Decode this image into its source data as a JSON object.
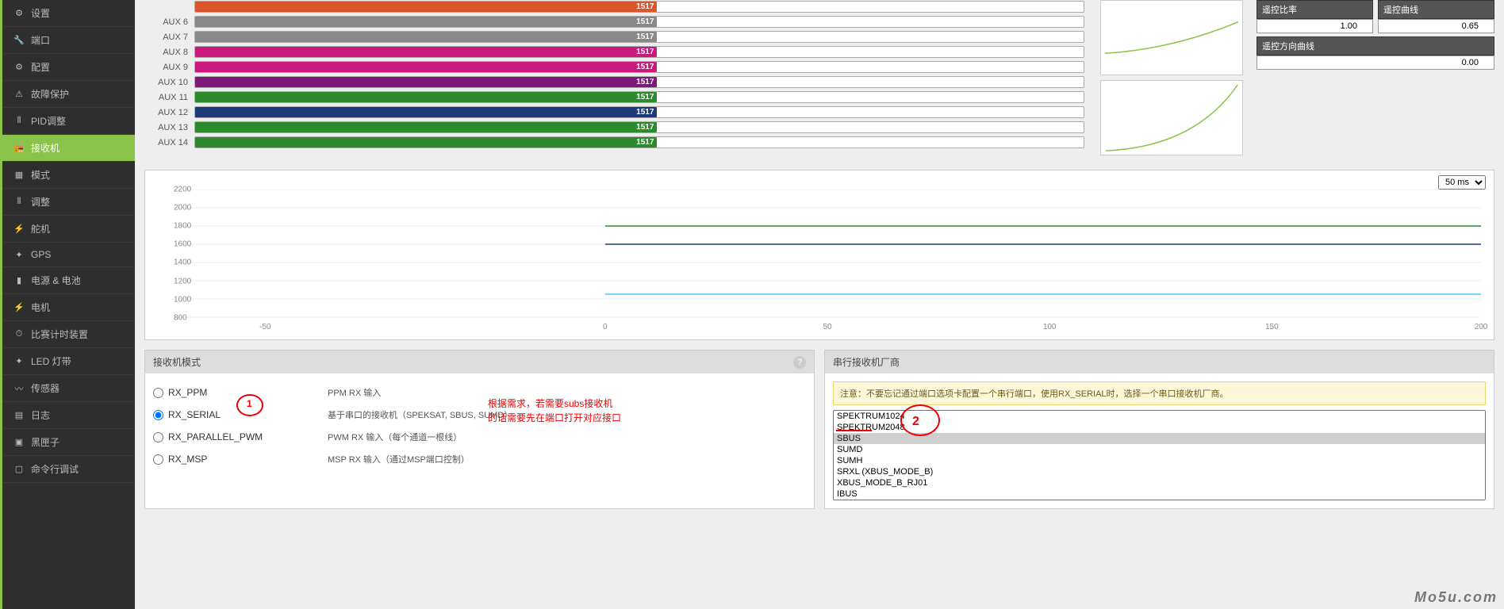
{
  "sidebar": {
    "items": [
      {
        "label": "设置",
        "icon": "gear"
      },
      {
        "label": "端口",
        "icon": "wrench"
      },
      {
        "label": "配置",
        "icon": "gear"
      },
      {
        "label": "故障保护",
        "icon": "warning"
      },
      {
        "label": "PID调整",
        "icon": "sliders"
      },
      {
        "label": "接收机",
        "icon": "radio",
        "active": true
      },
      {
        "label": "模式",
        "icon": "grid"
      },
      {
        "label": "调整",
        "icon": "sliders"
      },
      {
        "label": "舵机",
        "icon": "motor"
      },
      {
        "label": "GPS",
        "icon": "gps"
      },
      {
        "label": "电源 & 电池",
        "icon": "battery"
      },
      {
        "label": "电机",
        "icon": "plug"
      },
      {
        "label": "比赛计时装置",
        "icon": "timer"
      },
      {
        "label": "LED 灯带",
        "icon": "led"
      },
      {
        "label": "传感器",
        "icon": "sensor"
      },
      {
        "label": "日志",
        "icon": "log"
      },
      {
        "label": "黑匣子",
        "icon": "box"
      },
      {
        "label": "命令行调试",
        "icon": "terminal"
      }
    ]
  },
  "channels": [
    {
      "name": "AUX 6",
      "value": "1517",
      "color": "#888888"
    },
    {
      "name": "AUX 7",
      "value": "1517",
      "color": "#888888"
    },
    {
      "name": "AUX 8",
      "value": "1517",
      "color": "#c9197d"
    },
    {
      "name": "AUX 9",
      "value": "1517",
      "color": "#c9197d"
    },
    {
      "name": "AUX 10",
      "value": "1517",
      "color": "#7b1878"
    },
    {
      "name": "AUX 11",
      "value": "1517",
      "color": "#2b8a2b"
    },
    {
      "name": "AUX 12",
      "value": "1517",
      "color": "#1a3a7a"
    },
    {
      "name": "AUX 13",
      "value": "1517",
      "color": "#2b8a2b"
    },
    {
      "name": "AUX 14",
      "value": "1517",
      "color": "#2b8a2b"
    }
  ],
  "channel_top": {
    "value": "1517",
    "color": "#d9552c"
  },
  "rates": {
    "rc_rate_label": "遥控比率",
    "rc_curve_label": "遥控曲线",
    "rc_rate_value": "1.00",
    "rc_curve_value": "0.65",
    "rc_yaw_label": "遥控方向曲线",
    "rc_yaw_value": "0.00"
  },
  "graph": {
    "refresh": "50 ms",
    "yticks": [
      "2200",
      "2000",
      "1800",
      "1600",
      "1400",
      "1200",
      "1000",
      "800"
    ],
    "xticks": [
      "-50",
      "0",
      "50",
      "100",
      "150",
      "200"
    ]
  },
  "rx_mode": {
    "header": "接收机模式",
    "options": [
      {
        "id": "RX_PPM",
        "label": "RX_PPM",
        "desc": "PPM RX 输入"
      },
      {
        "id": "RX_SERIAL",
        "label": "RX_SERIAL",
        "desc": "基于串口的接收机（SPEKSAT, SBUS, SUMD）",
        "checked": true
      },
      {
        "id": "RX_PARALLEL_PWM",
        "label": "RX_PARALLEL_PWM",
        "desc": "PWM RX 输入（每个通道一根线）"
      },
      {
        "id": "RX_MSP",
        "label": "RX_MSP",
        "desc": "MSP RX 输入（通过MSP端口控制）"
      }
    ]
  },
  "serial_provider": {
    "header": "串行接收机厂商",
    "notice": "注意：不要忘记通过端口选项卡配置一个串行端口，使用RX_SERIAL时，选择一个串口接收机厂商。",
    "options": [
      "SPEKTRUM1024",
      "SPEKTRUM2048",
      "SBUS",
      "SUMD",
      "SUMH",
      "SRXL (XBUS_MODE_B)",
      "XBUS_MODE_B_RJ01",
      "IBUS"
    ],
    "selected": "SBUS"
  },
  "annotations": {
    "one": "1",
    "two": "2",
    "note1": "根据需求，若需要subs接收机",
    "note2": "的话需要先在端口打开对应接口"
  },
  "watermark": "Mo5u.com",
  "chart_data": {
    "type": "line",
    "title": "",
    "xlabel": "",
    "ylabel": "",
    "xlim": [
      -50,
      200
    ],
    "ylim": [
      800,
      2200
    ],
    "series": [
      {
        "name": "ch_green",
        "color": "#2b8a2b",
        "y": 1800
      },
      {
        "name": "ch_navy",
        "color": "#1a3a7a",
        "y": 1600
      },
      {
        "name": "ch_cyan",
        "color": "#4fc3f7",
        "y": 1050
      }
    ],
    "note": "flat lines from x≈0 onward at listed y values"
  }
}
